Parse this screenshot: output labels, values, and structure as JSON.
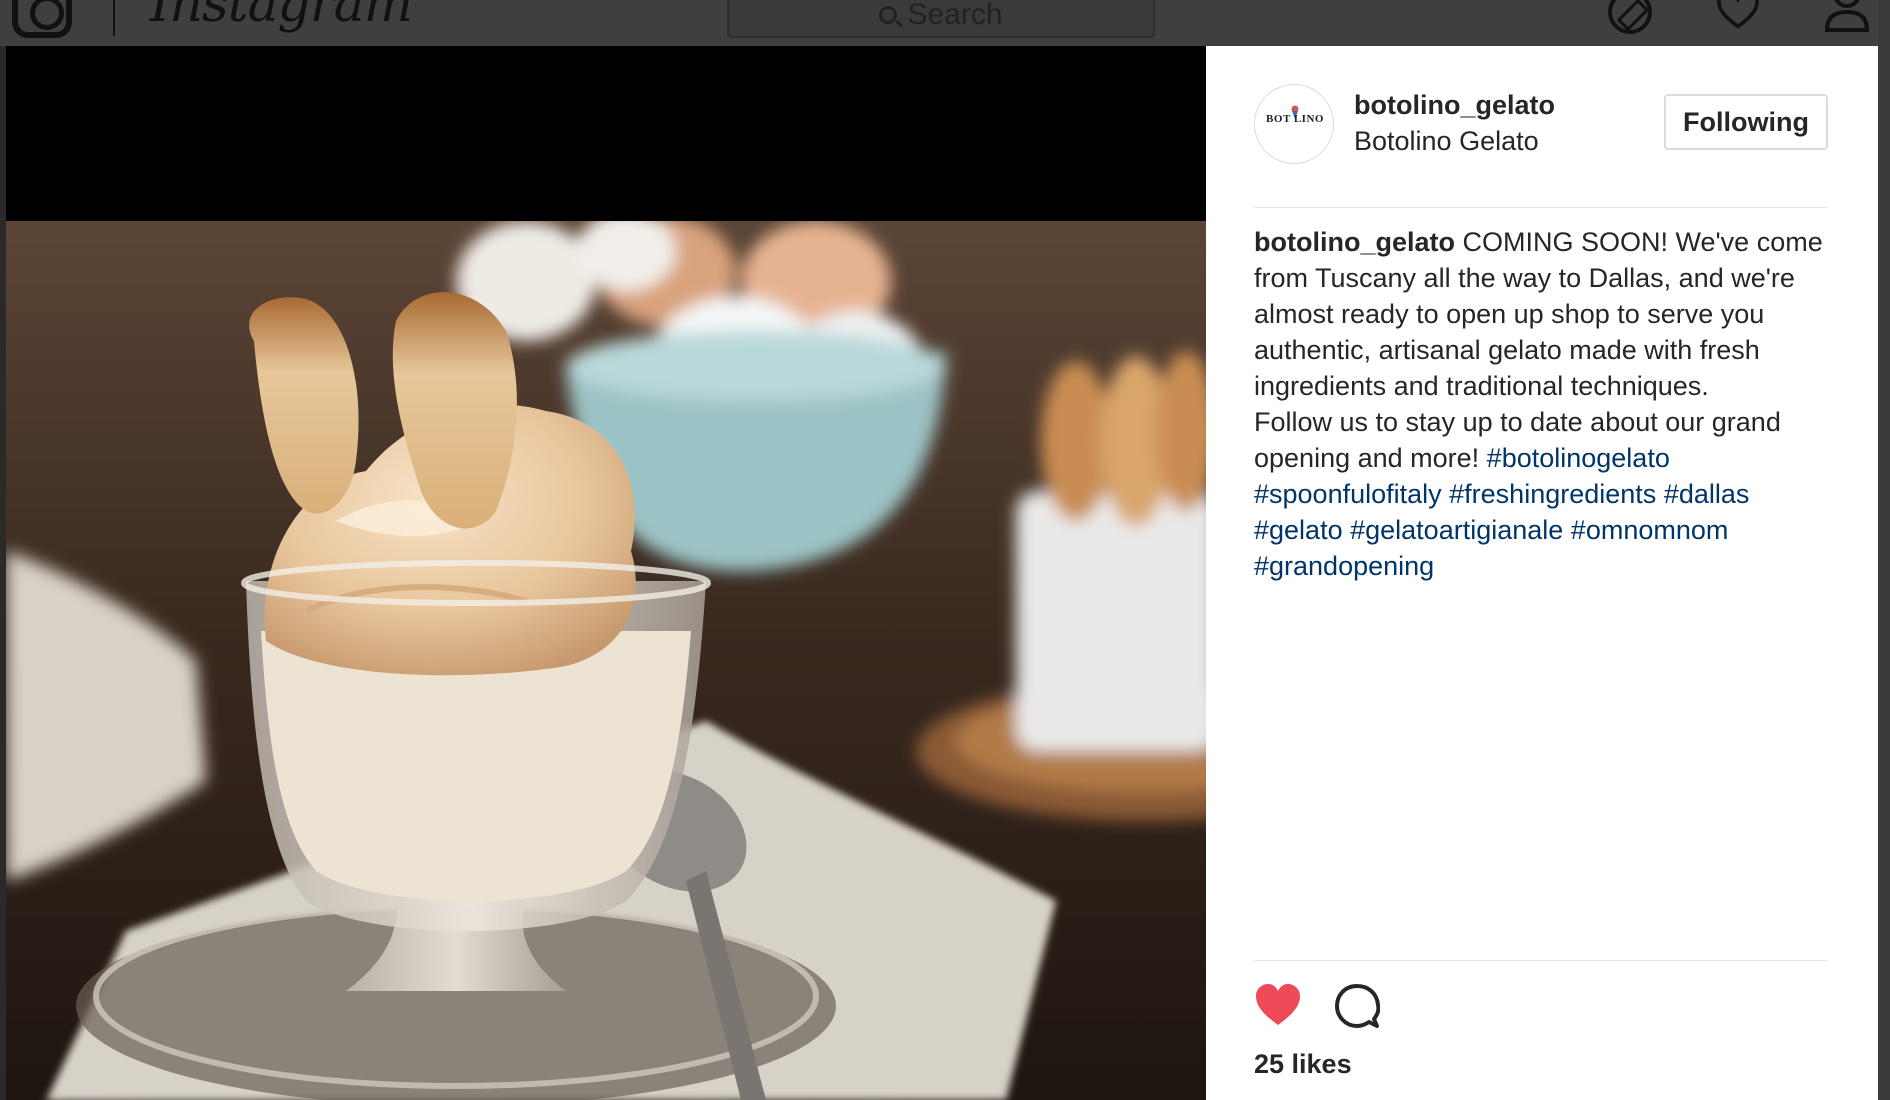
{
  "nav": {
    "wordmark": "Instagram",
    "search_placeholder": "Search",
    "icons": [
      "instagram-camera-icon",
      "compass-icon",
      "heart-icon",
      "profile-icon"
    ]
  },
  "post": {
    "photo_alt": "Gelato in a glass dish with langue de chat cookies",
    "author": {
      "username": "botolino_gelato",
      "full_name": "Botolino Gelato",
      "avatar_text": "BOT LINO",
      "follow_label": "Following"
    },
    "caption": {
      "username": "botolino_gelato",
      "text": "COMING SOON! We've come from Tuscany all the way to Dallas, and we're almost ready to open up shop to serve you authentic, artisanal gelato made with fresh ingredients and traditional techniques.\nFollow us to stay up to date about our grand opening and more! ",
      "hashtags": [
        "#botolinogelato",
        "#spoonfulofitaly",
        "#freshingredients",
        "#dallas",
        "#gelato",
        "#gelatoartigianale",
        "#omnomnom",
        "#grandopening"
      ]
    },
    "likes_text": "25 likes",
    "liked": true,
    "like_color": "#ed4956",
    "hashtag_color": "#003569"
  }
}
